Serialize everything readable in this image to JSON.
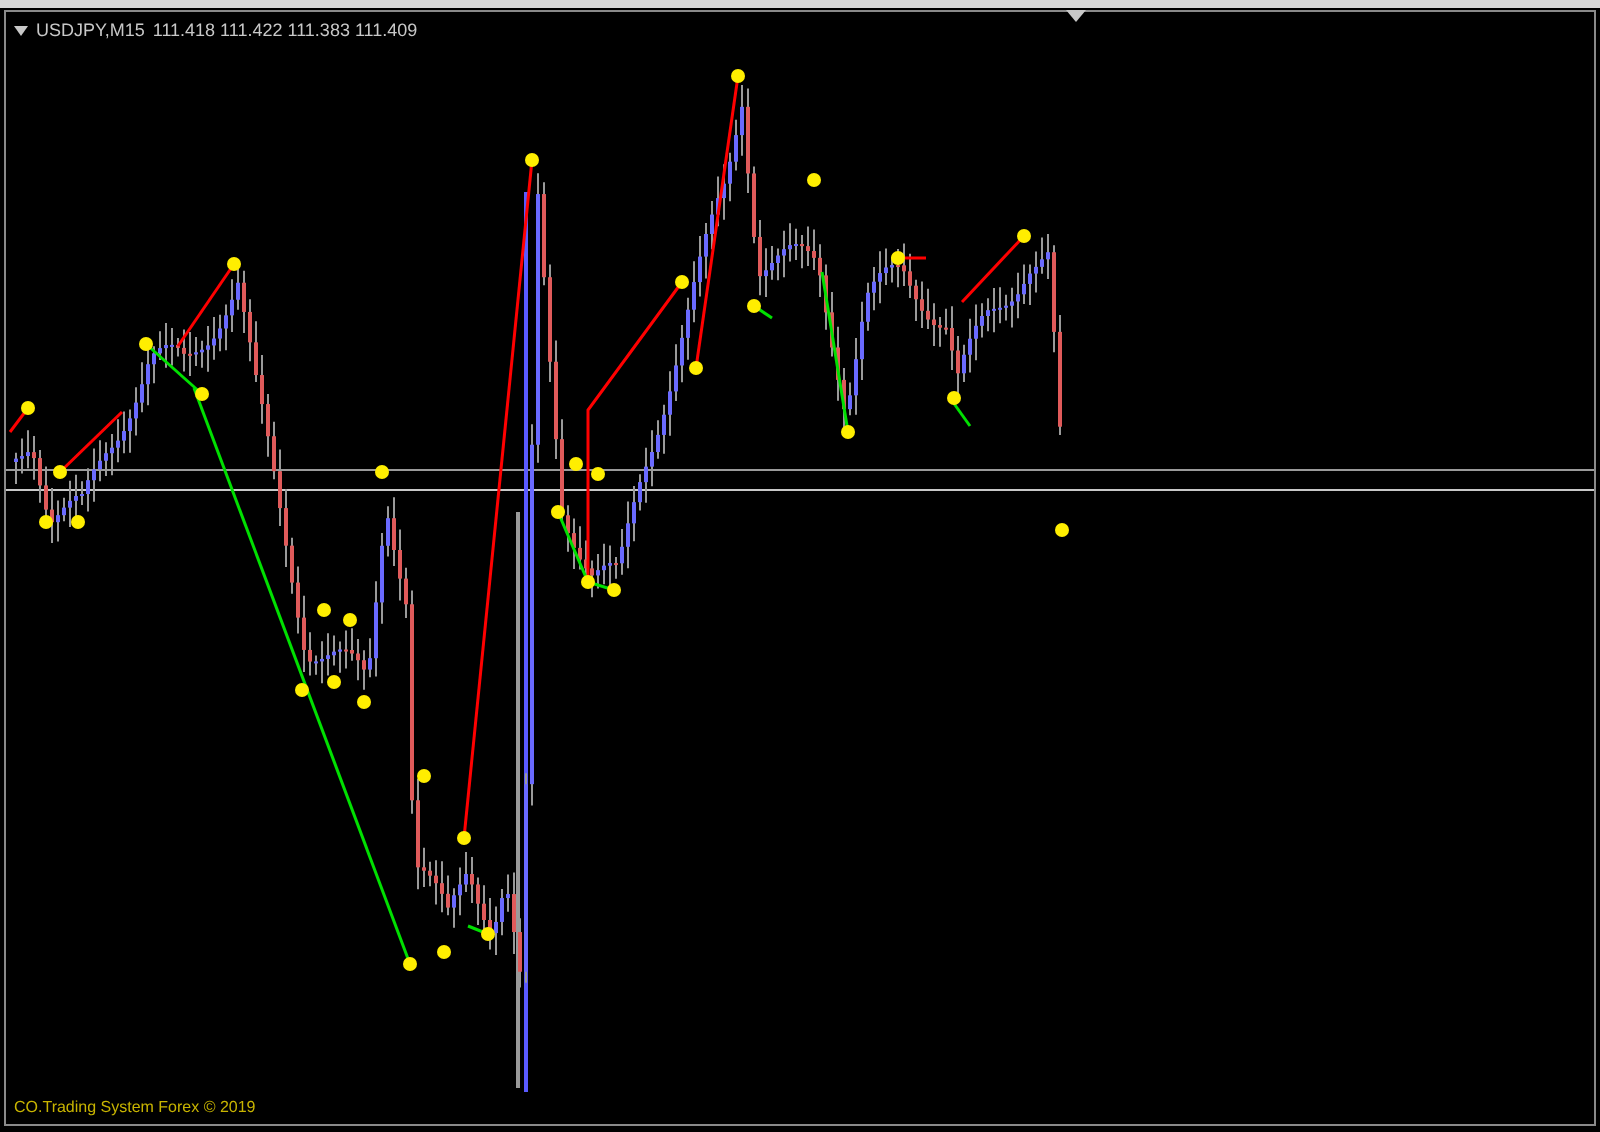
{
  "chart": {
    "symbol": "USDJPY,M15",
    "quotes": "111.418 111.422 111.383 111.409",
    "footer": "CO.Trading System Forex © 2019"
  }
}
